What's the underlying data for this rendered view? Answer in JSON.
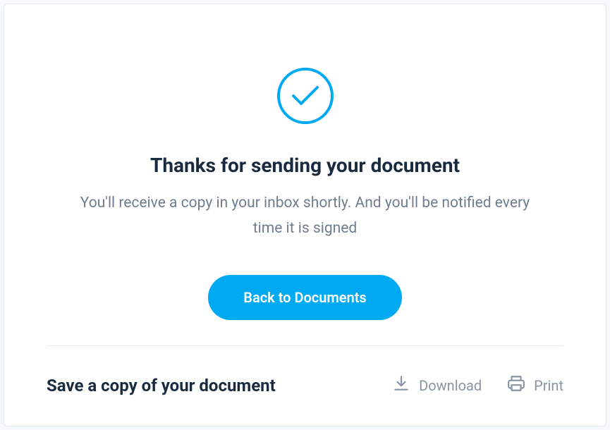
{
  "main": {
    "title": "Thanks for sending your document",
    "subtitle": "You'll receive a copy in your inbox shortly. And you'll be notified every time it is signed",
    "primary_button_label": "Back to Documents"
  },
  "footer": {
    "title": "Save a copy of your document",
    "download_label": "Download",
    "print_label": "Print"
  },
  "icons": {
    "checkmark": "checkmark-icon",
    "download": "download-icon",
    "print": "print-icon"
  },
  "colors": {
    "accent": "#00aaf2",
    "text_primary": "#1a2b3f",
    "text_secondary": "#6f7d8e",
    "text_muted": "#8995a3",
    "border": "#e3eaf0"
  }
}
